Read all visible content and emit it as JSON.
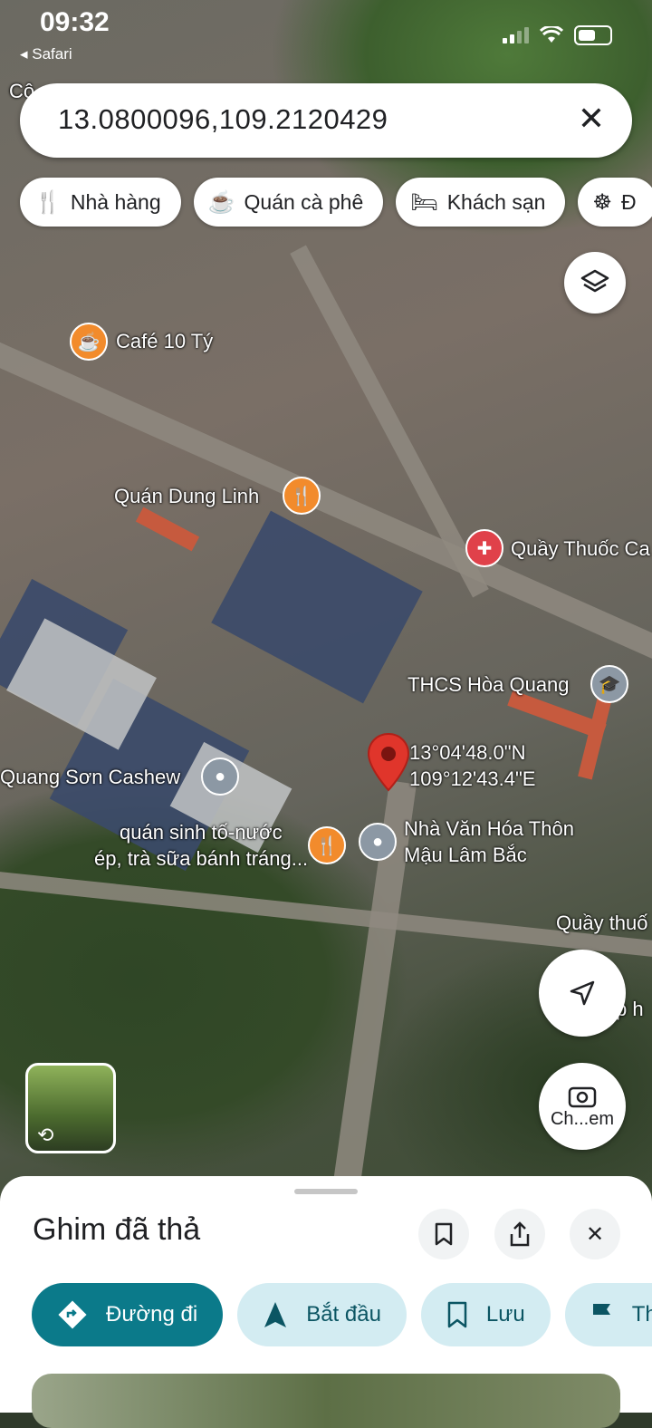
{
  "status_bar": {
    "time": "09:32",
    "back_app": "Safari"
  },
  "search": {
    "query": "13.0800096,109.2120429"
  },
  "chips": [
    {
      "icon": "restaurant-icon",
      "label": "Nhà hàng"
    },
    {
      "icon": "coffee-icon",
      "label": "Quán cà phê"
    },
    {
      "icon": "hotel-icon",
      "label": "Khách sạn"
    },
    {
      "icon": "attraction-icon",
      "label": "Đ"
    }
  ],
  "map": {
    "labels": {
      "top_left": "Cô",
      "cafe": "Café 10 Tý",
      "quan_dung_linh": "Quán Dung Linh",
      "quay_thuoc": "Quầy Thuốc Ca",
      "thcs": "THCS Hòa Quang",
      "coord_lat": "13°04'48.0\"N",
      "coord_lon": "109°12'43.4\"E",
      "quang_son": "Quang Sơn Cashew",
      "quan_sinh_to_1": "quán sinh tố-nước",
      "quan_sinh_to_2": "ép, trà sữa bánh tráng...",
      "nha_van_hoa_1": "Nhà Văn Hóa Thôn",
      "nha_van_hoa_2": "Mậu Lâm Bắc",
      "quay_thuoc_2": "Quầy thuố",
      "right_edge": "p h"
    },
    "lens_label": "Ch...em"
  },
  "sheet": {
    "title": "Ghim đã thả",
    "actions": [
      {
        "label": "Đường đi",
        "icon": "directions-icon"
      },
      {
        "label": "Bắt đầu",
        "icon": "navigation-icon"
      },
      {
        "label": "Lưu",
        "icon": "bookmark-icon"
      },
      {
        "label": "Th",
        "icon": "flag-icon"
      }
    ]
  }
}
